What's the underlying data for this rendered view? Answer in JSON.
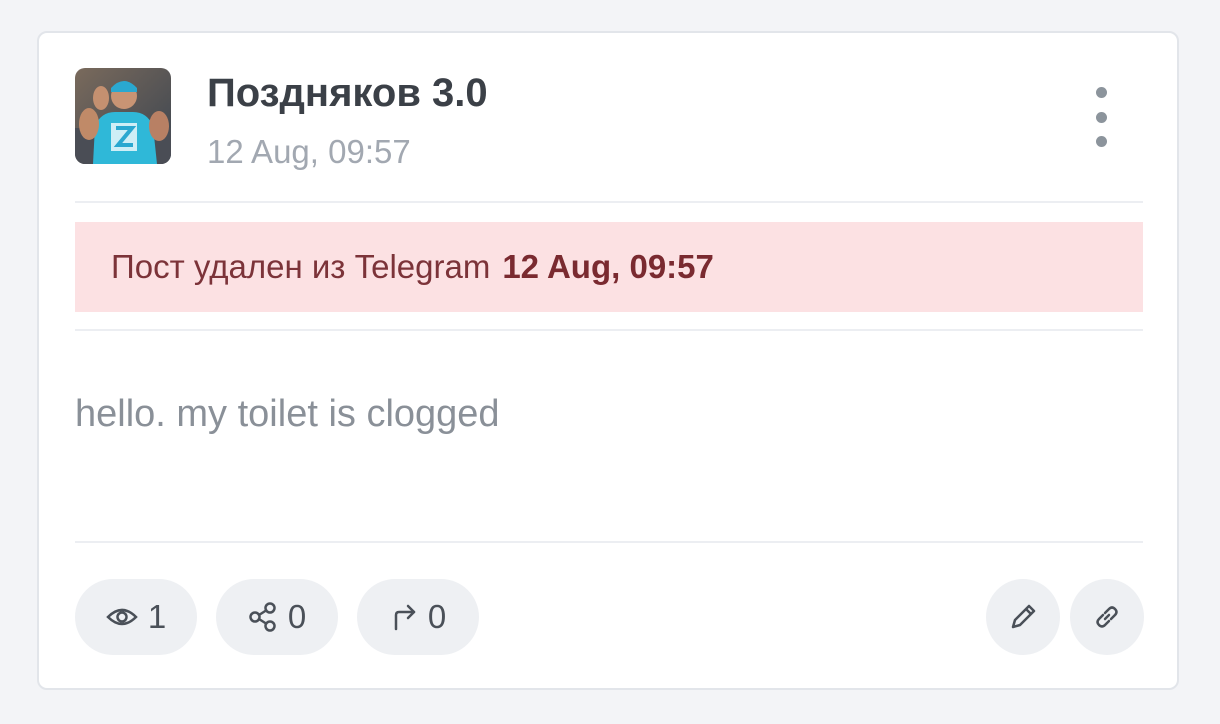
{
  "post": {
    "author": "Поздняков 3.0",
    "timestamp": "12 Aug, 09:57",
    "avatar_icon": "profile-photo",
    "menu_icon": "more-vertical-icon",
    "deleted_banner": {
      "text": "Пост удален из Telegram",
      "date": "12 Aug, 09:57",
      "background": "#fce1e3",
      "text_color": "#7c3339"
    },
    "content": "hello. my toilet is clogged",
    "stats": {
      "views": "1",
      "shares": "0",
      "forwards": "0"
    },
    "actions": {
      "edit_icon": "pencil-icon",
      "link_icon": "link-icon"
    }
  },
  "colors": {
    "page_bg": "#f3f4f7",
    "card_bg": "#ffffff",
    "pill_bg": "#eef0f3",
    "muted_text": "#a2a8b1"
  }
}
